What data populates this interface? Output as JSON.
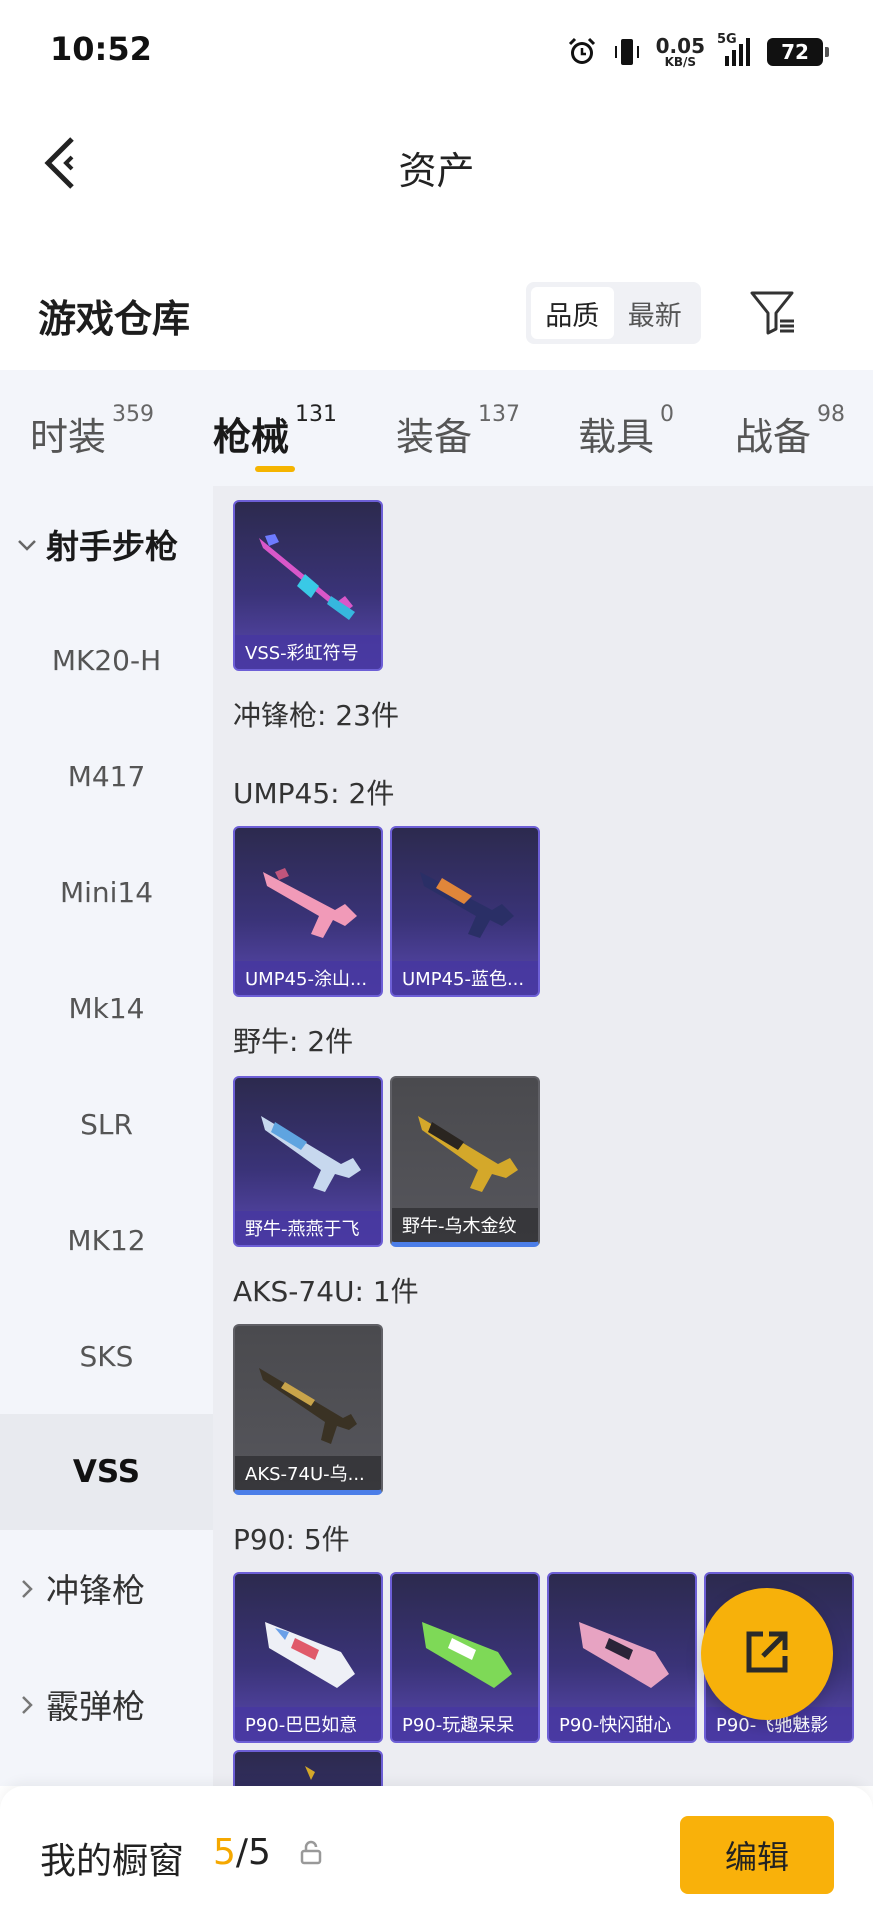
{
  "status_bar": {
    "time": "10:52",
    "net_speed_value": "0.05",
    "net_speed_unit": "KB/S",
    "signal_label": "5G",
    "battery": "72",
    "icons": [
      "alarm-icon",
      "vibrate-icon",
      "signal-icon",
      "battery-icon"
    ]
  },
  "header": {
    "title": "资产",
    "back_icon": "chevron-left-icon"
  },
  "section": {
    "title": "游戏仓库",
    "sort_options": [
      "品质",
      "最新"
    ],
    "sort_selected": "品质",
    "filter_icon": "filter-icon"
  },
  "tabs": [
    {
      "label": "时装",
      "count": "359"
    },
    {
      "label": "枪械",
      "count": "131",
      "active": true
    },
    {
      "label": "装备",
      "count": "137"
    },
    {
      "label": "载具",
      "count": "0"
    },
    {
      "label": "战备",
      "count": "98"
    }
  ],
  "categories": {
    "group_open": "射手步枪",
    "items": [
      "MK20-H",
      "M417",
      "Mini14",
      "Mk14",
      "SLR",
      "MK12",
      "SKS",
      "VSS"
    ],
    "active_item": "VSS",
    "collapsed_groups": [
      "冲锋枪",
      "霰弹枪"
    ]
  },
  "content": {
    "vss_items": [
      "VSS-彩虹符号"
    ],
    "smg_summary": "冲锋枪: 23件",
    "groups": [
      {
        "title": "UMP45: 2件",
        "items": [
          "UMP45-涂山...",
          "UMP45-蓝色..."
        ]
      },
      {
        "title": "野牛: 2件",
        "items": [
          "野牛-燕燕于飞",
          "野牛-乌木金纹"
        ]
      },
      {
        "title": "AKS-74U: 1件",
        "items": [
          "AKS-74U-乌..."
        ]
      },
      {
        "title": "P90: 5件",
        "items": [
          "P90-巴巴如意",
          "P90-玩趣呆呆",
          "P90-快闪甜心",
          "P90-飞驰魅影"
        ]
      }
    ]
  },
  "fab": {
    "icon": "share-icon"
  },
  "bottom_bar": {
    "title": "我的橱窗",
    "count_current": "5",
    "count_total": "/5",
    "lock_icon": "lock-icon",
    "edit_label": "编辑"
  },
  "colors": {
    "accent": "#f7b10a",
    "tab_bg": "#f3f5fa",
    "content_bg": "#ecedf2",
    "card_purple": "#3a3378",
    "card_gray": "#56565c"
  }
}
